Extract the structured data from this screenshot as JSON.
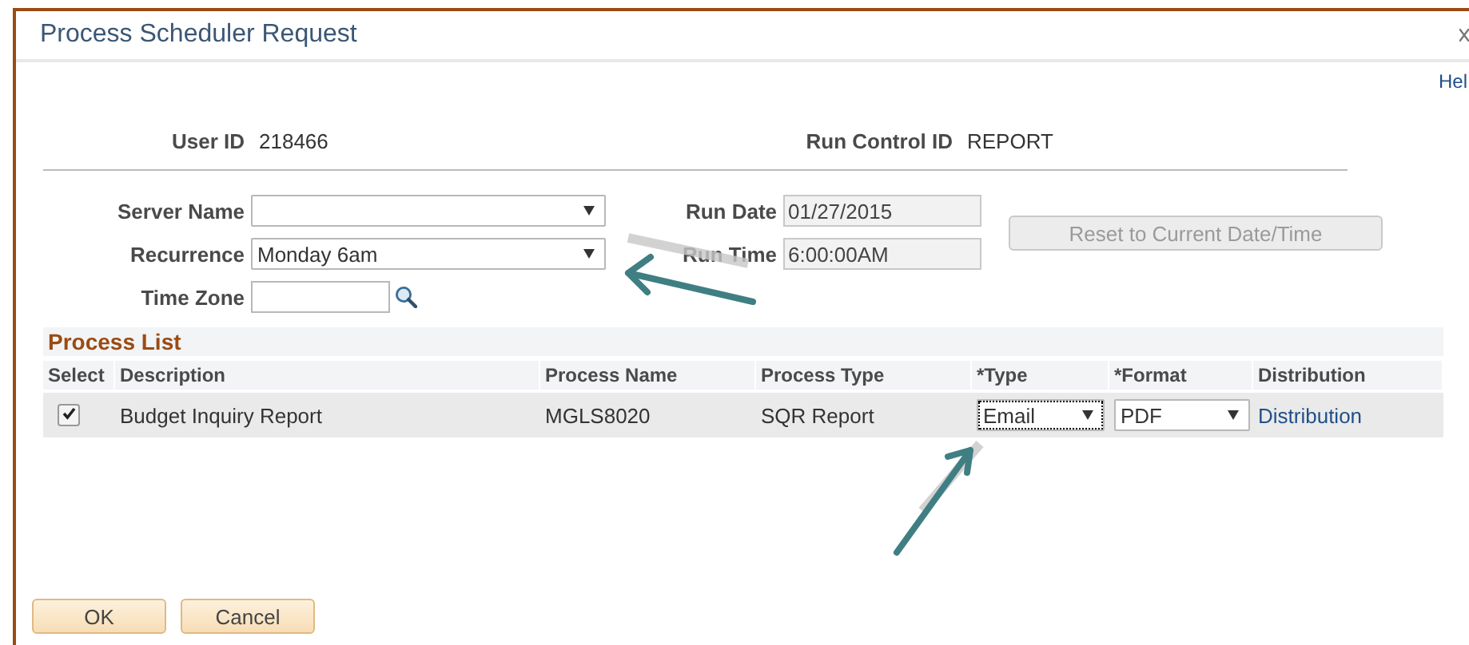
{
  "window": {
    "title": "Process Scheduler Request"
  },
  "help_link": "Hel",
  "header": {
    "user_id_label": "User ID",
    "user_id": "218466",
    "run_control_label": "Run Control ID",
    "run_control_id": "REPORT"
  },
  "fields": [
    {
      "label": "Server Name",
      "kind": "dropdown"
    },
    {
      "label": "Recurrence",
      "kind": "dropdown",
      "value": "Monday 6am"
    },
    {
      "label": "Time Zone",
      "kind": "lookup"
    }
  ],
  "run_fields": [
    {
      "label": "Run Date",
      "value": "01/27/2015"
    },
    {
      "label": "Run Time",
      "value": "6:00:00AM"
    }
  ],
  "reset_button": {
    "label": "Reset to Current Date/Time",
    "disabled": true
  },
  "process_list": {
    "title": "Process List",
    "columns": [
      "Select",
      "Description",
      "Process Name",
      "Process Type",
      "*Type",
      "*Format",
      "Distribution"
    ],
    "rows": [
      {
        "checked": true,
        "description": "Budget Inquiry Report",
        "process_name": "MGLS8020",
        "process_type": "SQR Report",
        "type": "Email",
        "format": "PDF",
        "distribution": "Distribution"
      }
    ]
  },
  "buttons": [
    {
      "label": "OK"
    },
    {
      "label": "Cancel"
    }
  ]
}
